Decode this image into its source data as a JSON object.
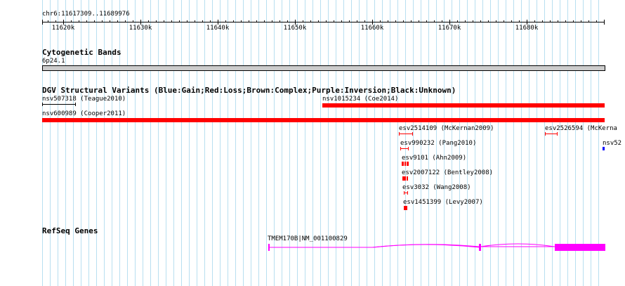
{
  "ruler": {
    "position": "chr6:11617309..11689976",
    "ticks": [
      "11620k",
      "11630k",
      "11640k",
      "11650k",
      "11660k",
      "11670k",
      "11680k"
    ]
  },
  "tracks": {
    "cytoband": {
      "title": "Cytogenetic Bands",
      "band": "6p24.1"
    },
    "dgv": {
      "title": "DGV Structural Variants (Blue:Gain;Red:Loss;Brown:Complex;Purple:Inversion;Black:Unknown)",
      "features": [
        {
          "label": "nsv507318 (Teague2010)",
          "type": "Unknown",
          "color": "#000000"
        },
        {
          "label": "nsv1015234 (Coe2014)",
          "type": "Loss",
          "color": "#ff0000"
        },
        {
          "label": "nsv600989 (Cooper2011)",
          "type": "Loss",
          "color": "#ff0000"
        },
        {
          "label": "esv2514109 (McKernan2009)",
          "type": "Loss",
          "color": "#ff0000"
        },
        {
          "label": "esv2526594 (McKerna",
          "type": "Loss",
          "color": "#ff0000"
        },
        {
          "label": "nsv52",
          "type": "Gain",
          "color": "#0000ff"
        },
        {
          "label": "esv990232 (Pang2010)",
          "type": "Loss",
          "color": "#ff0000"
        },
        {
          "label": "esv9101 (Ahn2009)",
          "type": "Loss",
          "color": "#ff0000"
        },
        {
          "label": "esv2007122 (Bentley2008)",
          "type": "Loss",
          "color": "#ff0000"
        },
        {
          "label": "esv3032 (Wang2008)",
          "type": "Loss",
          "color": "#ff0000"
        },
        {
          "label": "esv1451399 (Levy2007)",
          "type": "Loss",
          "color": "#ff0000"
        }
      ]
    },
    "refseq": {
      "title": "RefSeq Genes",
      "genes": [
        {
          "label": "TMEM170B|NM_001100829",
          "color": "#ff00ff"
        }
      ]
    }
  }
}
